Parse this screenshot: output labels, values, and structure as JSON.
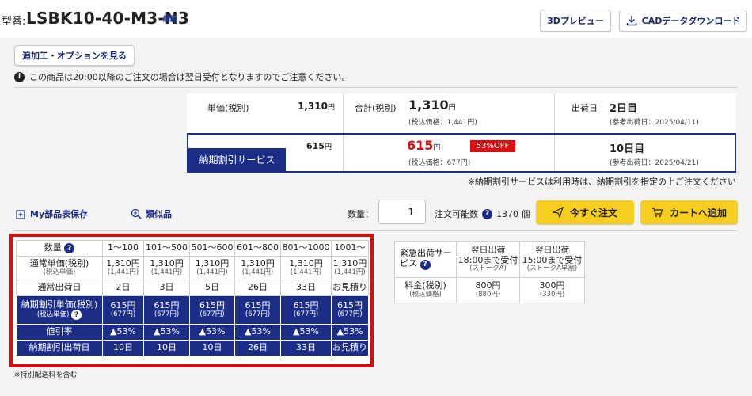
{
  "header": {
    "model_label": "型番:",
    "model_number": "LSBK10-40-M3-N3",
    "unlink_label": "解除",
    "preview_3d_label": "3Dプレビュー",
    "cad_download_label": "CADデータダウンロード"
  },
  "options_button_label": "追加工・オプションを見る",
  "notice_text": "この商品は20:00以降のご注文の場合は翌日受付となりますのでご注意ください。",
  "price_summary": {
    "unit_price_label": "単価(税別)",
    "unit_price": "1,310",
    "unit_price_yen": "円",
    "total_label": "合計(税別)",
    "total": "1,310",
    "total_yen": "円",
    "total_tax_incl": "(税込価格：1,441円)",
    "ship_label": "出荷日",
    "ship_days": "2日目",
    "ship_ref": "(参考出荷日：2025/04/11)",
    "nouki_tag": "納期割引サービス",
    "nouki_unit_price": "615",
    "nouki_unit_yen": "円",
    "nouki_total": "615",
    "nouki_total_yen": "円",
    "nouki_tax_incl": "(税込価格：677円)",
    "discount_badge": "53%OFF",
    "nouki_ship_days": "10日目",
    "nouki_ship_ref": "(参考出荷日：2025/04/21)",
    "nouki_note": "※納期割引サービスは利用時は、納期割引を指定の上ご注文ください"
  },
  "actions": {
    "save_parts_label": "My部品表保存",
    "similar_label": "類似品",
    "qty_label": "数量：",
    "qty_value": "1",
    "orderable_label": "注文可能数",
    "orderable_value": "1370 個",
    "buy_now_label": "今すぐ注文",
    "add_to_cart_label": "カートへ追加"
  },
  "price_table": {
    "qty_header": "数量",
    "qty_ranges": [
      "1～100",
      "101～500",
      "501～600",
      "601～800",
      "801～1000",
      "1001～"
    ],
    "normal_label": "通常単価(税別)",
    "normal_sub": "(税込単価)",
    "normal_prices": [
      "1,310円",
      "1,310円",
      "1,310円",
      "1,310円",
      "1,310円",
      "1,310円"
    ],
    "normal_tax": [
      "(1,441円)",
      "(1,441円)",
      "(1,441円)",
      "(1,441円)",
      "(1,441円)",
      "(1,441円)"
    ],
    "normal_ship_label": "通常出荷日",
    "normal_ship": [
      "2日",
      "3日",
      "5日",
      "26日",
      "33日",
      "お見積り"
    ],
    "nouki_label": "納期割引単価(税別)",
    "nouki_sub": "(税込単価)",
    "nouki_prices": [
      "615円",
      "615円",
      "615円",
      "615円",
      "615円",
      "615円"
    ],
    "nouki_tax": [
      "(677円)",
      "(677円)",
      "(677円)",
      "(677円)",
      "(677円)",
      "(677円)"
    ],
    "discount_label": "値引率",
    "discounts": [
      "▲53%",
      "▲53%",
      "▲53%",
      "▲53%",
      "▲53%",
      "▲53%"
    ],
    "nouki_ship_label": "納期割引出荷日",
    "nouki_ship": [
      "10日",
      "10日",
      "10日",
      "26日",
      "33日",
      "お見積り"
    ]
  },
  "footnote": "※特別配送料を含む",
  "express": {
    "service_label": "緊急出荷サービス",
    "cols": [
      {
        "title": "翌日出荷",
        "time": "18:00まで受付",
        "sub": "(ストークA)",
        "price": "800円",
        "tax": "(880円)"
      },
      {
        "title": "翌日出荷",
        "time": "15:00まで受付",
        "sub": "(ストークA早割)",
        "price": "300円",
        "tax": "(330円)"
      }
    ],
    "fee_label": "料金(税別)",
    "fee_sub": "(税込価格)"
  },
  "colors": {
    "navy": "#1b2d86",
    "accent_red": "#d90e0e",
    "button_yellow": "#f7ce1f"
  }
}
